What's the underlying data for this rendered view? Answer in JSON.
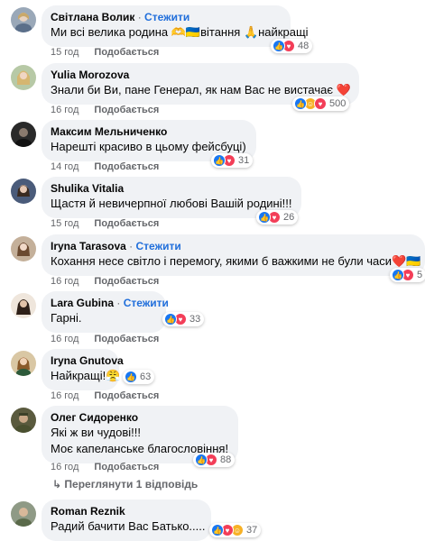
{
  "comments": [
    {
      "name": "Світлана Волик",
      "follow": "Стежити",
      "text": "Ми всі велика родина 🫶🇺🇦вітання 🙏найкращі",
      "time": "15 год",
      "like": "Подобається",
      "count": "48",
      "reactions": [
        "like",
        "love"
      ]
    },
    {
      "name": "Yulia Morozova",
      "follow": "",
      "text": "Знали би Ви, пане Генерал, як нам Вас не вистачає ❤️",
      "time": "16 год",
      "like": "Подобається",
      "count": "500",
      "reactions": [
        "like",
        "care",
        "love"
      ]
    },
    {
      "name": "Максим Мельниченко",
      "follow": "",
      "text": "Нарешті красиво в цьому фейсбуці)",
      "time": "14 год",
      "like": "Подобається",
      "count": "31",
      "reactions": [
        "like",
        "love"
      ]
    },
    {
      "name": "Shulika Vitalia",
      "follow": "",
      "text": "Щастя й невичерпної любові Вашій родині!!!",
      "time": "15 год",
      "like": "Подобається",
      "count": "26",
      "reactions": [
        "like",
        "love"
      ]
    },
    {
      "name": "Iryna Tarasova",
      "follow": "Стежити",
      "text": "Кохання несе світло і перемогу, якими б важкими не були часи❤️🇺🇦",
      "time": "16 год",
      "like": "Подобається",
      "count": "5",
      "reactions": [
        "like",
        "love"
      ]
    },
    {
      "name": "Lara Gubina",
      "follow": "Стежити",
      "text": "Гарні.",
      "time": "16 год",
      "like": "Подобається",
      "count": "33",
      "reactions": [
        "like",
        "love"
      ]
    },
    {
      "name": "Iryna Gnutova",
      "follow": "",
      "text": "Найкращі!😤",
      "time": "16 год",
      "like": "Подобається",
      "count": "63",
      "reactions": [
        "like"
      ]
    },
    {
      "name": "Олег Сидоренко",
      "follow": "",
      "text": "Які ж ви чудові!!!",
      "text2": "Моє капеланське благословіння!",
      "time": "16 год",
      "like": "Подобається",
      "count": "88",
      "reactions": [
        "like",
        "love"
      ]
    },
    {
      "name": "Roman Reznik",
      "follow": "",
      "text": "Радий бачити Вас Батько.....",
      "time": "",
      "like": "",
      "count": "37",
      "reactions": [
        "like",
        "love",
        "care"
      ]
    }
  ],
  "replies_link": "Переглянути 1 відповідь",
  "dot": "·",
  "reply_icon": "reply-arrow-icon"
}
